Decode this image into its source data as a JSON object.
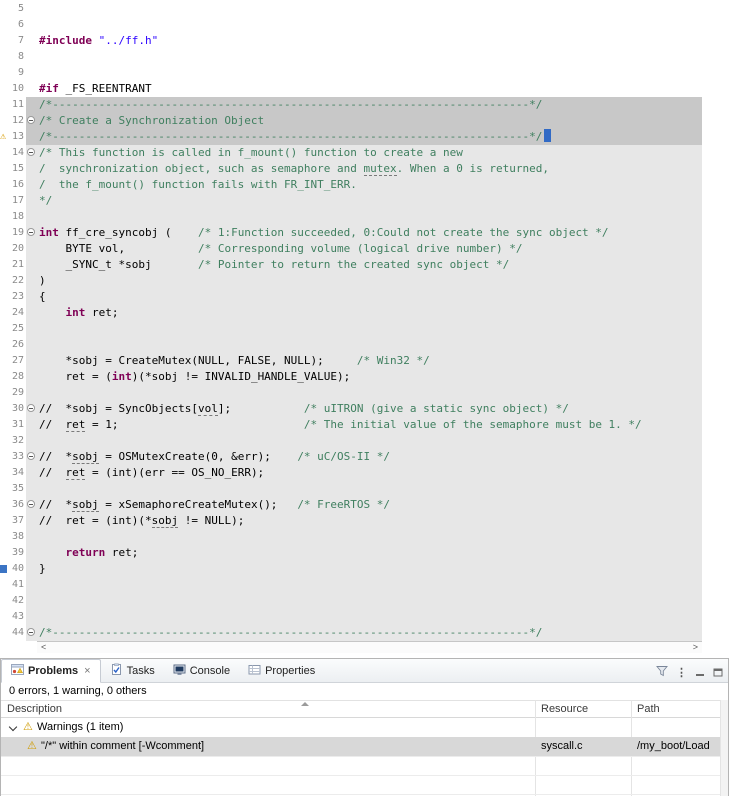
{
  "icons": {
    "warning": "⚠",
    "close": "×",
    "view_menu": "⋮",
    "scroll_left": "<",
    "scroll_right": ">"
  },
  "colors": {
    "keyword": "#7f0055",
    "string": "#2a00ff",
    "comment": "#3f7f5f",
    "selection_gray": "#c8c8c8",
    "block_highlight_gray": "#e7e7e7",
    "selected_row_gray": "#d8d8d8",
    "warning_yellow": "#cf9b00",
    "marker_blue": "#3b74c4"
  },
  "editor": {
    "lines": [
      {
        "num": 5,
        "seg": []
      },
      {
        "num": 6,
        "seg": []
      },
      {
        "num": 7,
        "seg": [
          {
            "t": "#include ",
            "c": "k"
          },
          {
            "t": "\"../ff.h\"",
            "c": "s"
          }
        ]
      },
      {
        "num": 8,
        "seg": []
      },
      {
        "num": 9,
        "seg": []
      },
      {
        "num": 10,
        "seg": [
          {
            "t": "#if",
            "c": "k"
          },
          {
            "t": " _FS_REENTRANT",
            "c": "p"
          }
        ]
      },
      {
        "num": 11,
        "hl": "sel",
        "seg": [
          {
            "t": "/*------------------------------------------------------------------------*/",
            "c": "c"
          }
        ]
      },
      {
        "num": 12,
        "hl": "sel",
        "fold": true,
        "seg": [
          {
            "t": "/* Create a Synchronization Object",
            "c": "c"
          }
        ]
      },
      {
        "num": 13,
        "hl": "sel",
        "warn": true,
        "cursor": true,
        "seg": [
          {
            "t": "/*------------------------------------------------------------------------*/",
            "c": "c"
          }
        ]
      },
      {
        "num": 14,
        "hl": "block",
        "fold": true,
        "seg": [
          {
            "t": "/* This function is called in f_mount() function to create a new",
            "c": "c"
          }
        ]
      },
      {
        "num": 15,
        "hl": "block",
        "seg": [
          {
            "t": "/  synchronization object, such as semaphore and ",
            "c": "c"
          },
          {
            "t": "mutex",
            "c": "cu"
          },
          {
            "t": ". When a 0 is returned,",
            "c": "c"
          }
        ]
      },
      {
        "num": 16,
        "hl": "block",
        "seg": [
          {
            "t": "/  the f_mount() function fails with FR_INT_ERR.",
            "c": "c"
          }
        ]
      },
      {
        "num": 17,
        "hl": "block",
        "seg": [
          {
            "t": "*/",
            "c": "c"
          }
        ]
      },
      {
        "num": 18,
        "hl": "block",
        "seg": []
      },
      {
        "num": 19,
        "hl": "block",
        "fold": true,
        "seg": [
          {
            "t": "int",
            "c": "k"
          },
          {
            "t": " ff_cre_syncobj (    ",
            "c": "p"
          },
          {
            "t": "/* 1:Function succeeded, 0:Could not create the sync object */",
            "c": "c"
          }
        ]
      },
      {
        "num": 20,
        "hl": "block",
        "seg": [
          {
            "t": "    BYTE vol,           ",
            "c": "p"
          },
          {
            "t": "/* Corresponding volume (logical drive number) */",
            "c": "c"
          }
        ]
      },
      {
        "num": 21,
        "hl": "block",
        "seg": [
          {
            "t": "    _SYNC_t *sobj       ",
            "c": "p"
          },
          {
            "t": "/* Pointer to return the created sync object */",
            "c": "c"
          }
        ]
      },
      {
        "num": 22,
        "hl": "block",
        "seg": [
          {
            "t": ")",
            "c": "p"
          }
        ]
      },
      {
        "num": 23,
        "hl": "block",
        "seg": [
          {
            "t": "{",
            "c": "p"
          }
        ]
      },
      {
        "num": 24,
        "hl": "block",
        "seg": [
          {
            "t": "    ",
            "c": "p"
          },
          {
            "t": "int",
            "c": "k"
          },
          {
            "t": " ret;",
            "c": "p"
          }
        ]
      },
      {
        "num": 25,
        "hl": "block",
        "seg": []
      },
      {
        "num": 26,
        "hl": "block",
        "seg": []
      },
      {
        "num": 27,
        "hl": "block",
        "seg": [
          {
            "t": "    *sobj = CreateMutex(NULL, FALSE, NULL);     ",
            "c": "p"
          },
          {
            "t": "/* Win32 */",
            "c": "c"
          }
        ]
      },
      {
        "num": 28,
        "hl": "block",
        "seg": [
          {
            "t": "    ret = (",
            "c": "p"
          },
          {
            "t": "int",
            "c": "k"
          },
          {
            "t": ")(*sobj != INVALID_HANDLE_VALUE);",
            "c": "p"
          }
        ]
      },
      {
        "num": 29,
        "hl": "block",
        "seg": []
      },
      {
        "num": 30,
        "hl": "block",
        "fold": true,
        "seg": [
          {
            "t": "//  *sobj = SyncObjects[",
            "c": "p"
          },
          {
            "t": "vol",
            "c": "u"
          },
          {
            "t": "];           ",
            "c": "p"
          },
          {
            "t": "/* uITRON (give a static sync object) */",
            "c": "c"
          }
        ]
      },
      {
        "num": 31,
        "hl": "block",
        "seg": [
          {
            "t": "//  ",
            "c": "p"
          },
          {
            "t": "ret",
            "c": "u"
          },
          {
            "t": " = 1;                            ",
            "c": "p"
          },
          {
            "t": "/* The initial value of the semaphore must be 1. */",
            "c": "c"
          }
        ]
      },
      {
        "num": 32,
        "hl": "block",
        "seg": []
      },
      {
        "num": 33,
        "hl": "block",
        "fold": true,
        "seg": [
          {
            "t": "//  *",
            "c": "p"
          },
          {
            "t": "sobj",
            "c": "u"
          },
          {
            "t": " = OSMutexCreate(0, &err);    ",
            "c": "p"
          },
          {
            "t": "/* uC/OS-II */",
            "c": "c"
          }
        ]
      },
      {
        "num": 34,
        "hl": "block",
        "seg": [
          {
            "t": "//  ",
            "c": "p"
          },
          {
            "t": "ret",
            "c": "u"
          },
          {
            "t": " = (int)(err == OS_NO_ERR);",
            "c": "p"
          }
        ]
      },
      {
        "num": 35,
        "hl": "block",
        "seg": []
      },
      {
        "num": 36,
        "hl": "block",
        "fold": true,
        "seg": [
          {
            "t": "//  *",
            "c": "p"
          },
          {
            "t": "sobj",
            "c": "u"
          },
          {
            "t": " = xSemaphoreCreateMutex();   ",
            "c": "p"
          },
          {
            "t": "/* FreeRTOS */",
            "c": "c"
          }
        ]
      },
      {
        "num": 37,
        "hl": "block",
        "seg": [
          {
            "t": "//  ret = (int)(*",
            "c": "p"
          },
          {
            "t": "sobj",
            "c": "u"
          },
          {
            "t": " != NULL);",
            "c": "p"
          }
        ]
      },
      {
        "num": 38,
        "hl": "block",
        "seg": []
      },
      {
        "num": 39,
        "hl": "block",
        "seg": [
          {
            "t": "    ",
            "c": "p"
          },
          {
            "t": "return",
            "c": "k"
          },
          {
            "t": " ret;",
            "c": "p"
          }
        ]
      },
      {
        "num": 40,
        "hl": "block",
        "marker": true,
        "seg": [
          {
            "t": "}",
            "c": "p"
          }
        ]
      },
      {
        "num": 41,
        "hl": "block",
        "seg": []
      },
      {
        "num": 42,
        "hl": "block",
        "seg": []
      },
      {
        "num": 43,
        "hl": "block",
        "seg": []
      },
      {
        "num": 44,
        "hl": "block",
        "fold": true,
        "seg": [
          {
            "t": "/*------------------------------------------------------------------------*/",
            "c": "c"
          }
        ]
      }
    ]
  },
  "problems_panel": {
    "tabs": [
      {
        "label": "Problems",
        "active": true
      },
      {
        "label": "Tasks"
      },
      {
        "label": "Console"
      },
      {
        "label": "Properties"
      }
    ],
    "summary": "0 errors, 1 warning, 0 others",
    "table": {
      "columns": [
        "Description",
        "Resource",
        "Path"
      ],
      "group_row": {
        "label": "Warnings (1 item)",
        "expanded": true
      },
      "item_row": {
        "description": "\"/*\" within comment [-Wcomment]",
        "resource": "syscall.c",
        "path": "/my_boot/Load",
        "selected": true
      }
    }
  }
}
